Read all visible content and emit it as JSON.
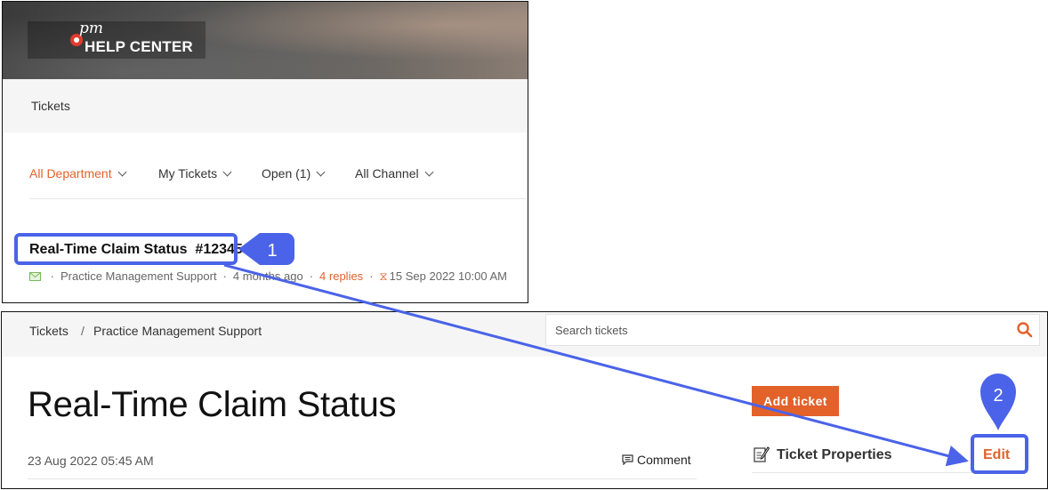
{
  "top_panel": {
    "logo": {
      "text": "HELP CENTER",
      "script": "pm"
    },
    "nav": {
      "tickets": "Tickets"
    },
    "filters": {
      "department": "All Department",
      "my_tickets": "My Tickets",
      "open": "Open (1)",
      "channel": "All Channel"
    },
    "ticket": {
      "title": "Real-Time Claim Status  #12345",
      "department": "Practice Management Support",
      "age": "4 months ago",
      "replies": "4 replies",
      "due": "15 Sep 2022 10:00 AM"
    }
  },
  "bottom_panel": {
    "breadcrumb": {
      "tickets": "Tickets",
      "separator": "/",
      "department": "Practice Management Support"
    },
    "search": {
      "placeholder": "Search tickets"
    },
    "title": "Real-Time Claim Status",
    "date": "23 Aug 2022 05:45 AM",
    "comment_label": "Comment",
    "add_ticket_label": "Add ticket",
    "properties_label": "Ticket Properties",
    "edit_label": "Edit"
  },
  "annotations": {
    "step1": "1",
    "step2": "2"
  },
  "colors": {
    "accent": "#e2622a",
    "annotation": "#4a63e8"
  }
}
